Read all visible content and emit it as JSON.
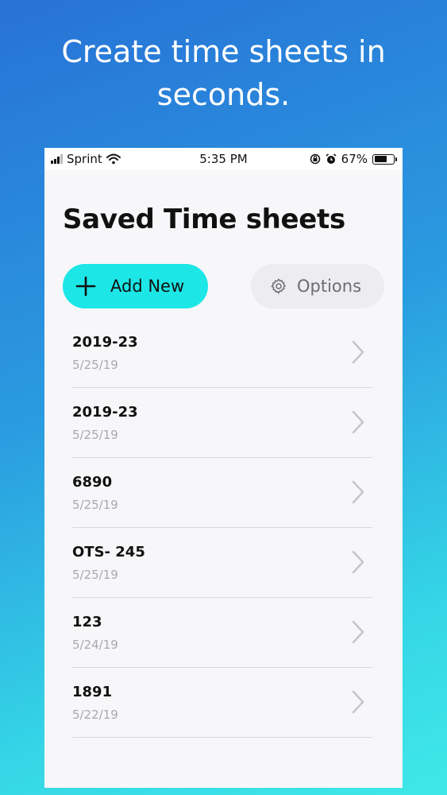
{
  "promo": {
    "headline_line1": "Create time sheets in",
    "headline_line2": "seconds."
  },
  "status_bar": {
    "carrier": "Sprint",
    "time": "5:35 PM",
    "battery_percent": "67%",
    "battery_level": 0.67
  },
  "screen": {
    "title": "Saved Time sheets",
    "add_button_label": "Add New",
    "options_button_label": "Options"
  },
  "timesheets": [
    {
      "name": "2019-23",
      "date": "5/25/19"
    },
    {
      "name": "2019-23",
      "date": "5/25/19"
    },
    {
      "name": "6890",
      "date": "5/25/19"
    },
    {
      "name": "OTS- 245",
      "date": "5/25/19"
    },
    {
      "name": "123",
      "date": "5/24/19"
    },
    {
      "name": "1891",
      "date": "5/22/19"
    }
  ],
  "colors": {
    "accent": "#1de6e6",
    "options_bg": "#ececf1",
    "date_text": "#a8a8ae"
  },
  "icons": {
    "add": "plus-icon",
    "options": "gear-icon",
    "row": "chevron-right-icon",
    "wifi": "wifi-icon",
    "alarm": "alarm-icon",
    "lock": "rotation-lock-icon",
    "battery": "battery-icon",
    "signal": "signal-icon"
  }
}
